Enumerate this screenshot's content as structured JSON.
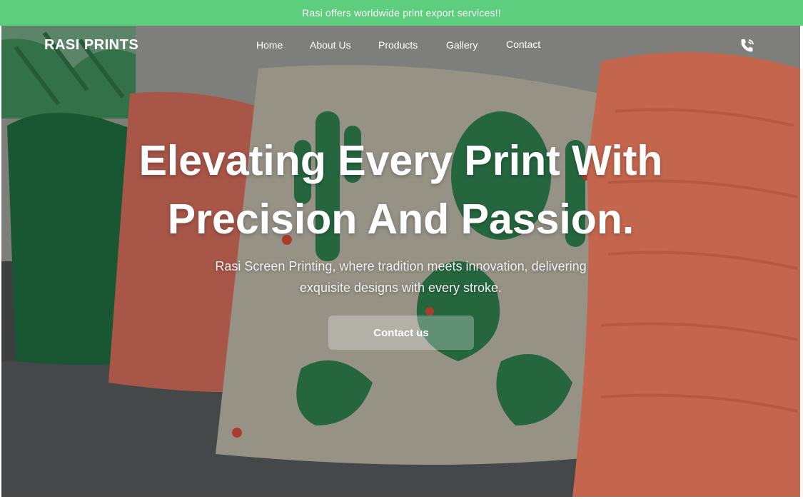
{
  "announcement": {
    "text": "Rasi offers worldwide print export services!!"
  },
  "header": {
    "logo": "RASI PRINTS",
    "nav": [
      {
        "label": "Home"
      },
      {
        "label": "About Us"
      },
      {
        "label": "Products"
      },
      {
        "label": "Gallery"
      },
      {
        "label": "Contact"
      }
    ],
    "phone_icon": "phone-icon"
  },
  "hero": {
    "headline_line1": "Elevating Every Print With",
    "headline_line2": "Precision And Passion.",
    "subtitle_line1": "Rasi Screen Printing, where tradition meets innovation, delivering",
    "subtitle_line2": "exquisite designs with every stroke.",
    "cta_label": "Contact us",
    "background_image": "pillows-on-sofa-photo"
  },
  "colors": {
    "announcement_bg": "#5dcd7e",
    "text": "#ffffff"
  }
}
